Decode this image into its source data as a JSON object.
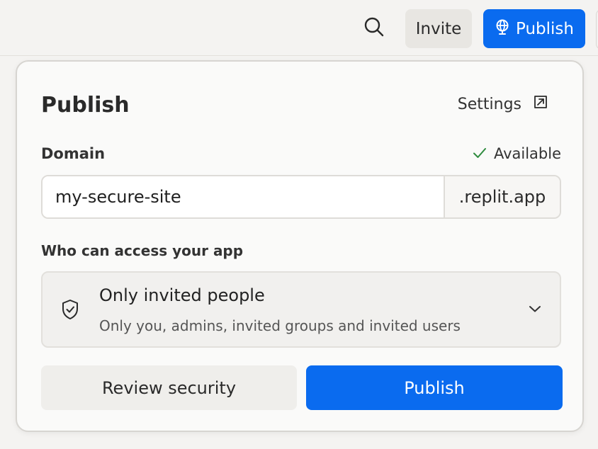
{
  "header": {
    "search_icon": "search-icon",
    "invite_label": "Invite",
    "publish_label": "Publish",
    "publish_icon": "globe-icon"
  },
  "panel": {
    "title": "Publish",
    "settings_label": "Settings",
    "settings_icon": "external-link-icon",
    "domain": {
      "label": "Domain",
      "status": "Available",
      "status_icon": "check-icon",
      "value": "my-secure-site",
      "suffix": ".replit.app"
    },
    "access": {
      "label": "Who can access your app",
      "icon": "shield-check-icon",
      "selected_title": "Only invited people",
      "selected_description": "Only you, admins, invited groups and invited users"
    },
    "actions": {
      "review_label": "Review security",
      "publish_label": "Publish"
    }
  },
  "colors": {
    "accent": "#0a6bef",
    "success": "#2e8b3e",
    "background": "#f4f3f1",
    "panel": "#fafaf9"
  }
}
